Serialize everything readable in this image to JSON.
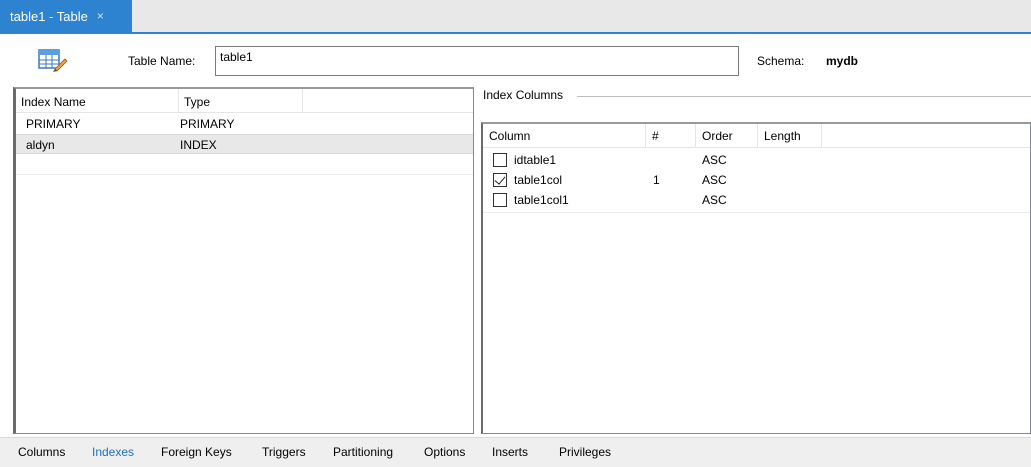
{
  "document_tab": {
    "title": "table1 - Table",
    "close_glyph": "×"
  },
  "header": {
    "icon": "table-edit-icon",
    "table_name_label": "Table Name:",
    "table_name_value": "table1",
    "schema_label": "Schema:",
    "schema_value": "mydb"
  },
  "indexes_grid": {
    "columns": [
      "Index Name",
      "Type"
    ],
    "rows": [
      {
        "name": "PRIMARY",
        "type": "PRIMARY",
        "selected": false
      },
      {
        "name": "aldyn",
        "type": "INDEX",
        "selected": true
      }
    ]
  },
  "index_columns": {
    "group_title": "Index Columns",
    "columns": [
      "Column",
      "#",
      "Order",
      "Length"
    ],
    "rows": [
      {
        "column": "idtable1",
        "checked": false,
        "number": "",
        "order": "ASC",
        "length": ""
      },
      {
        "column": "table1col",
        "checked": true,
        "number": "1",
        "order": "ASC",
        "length": ""
      },
      {
        "column": "table1col1",
        "checked": false,
        "number": "",
        "order": "ASC",
        "length": ""
      }
    ]
  },
  "bottom_tabs": {
    "items": [
      "Columns",
      "Indexes",
      "Foreign Keys",
      "Triggers",
      "Partitioning",
      "Options",
      "Inserts",
      "Privileges"
    ],
    "active": "Indexes"
  },
  "colors": {
    "accent": "#2d83d0",
    "active_tab_text": "#1e6fbf",
    "selection": "#e8e8e8"
  }
}
